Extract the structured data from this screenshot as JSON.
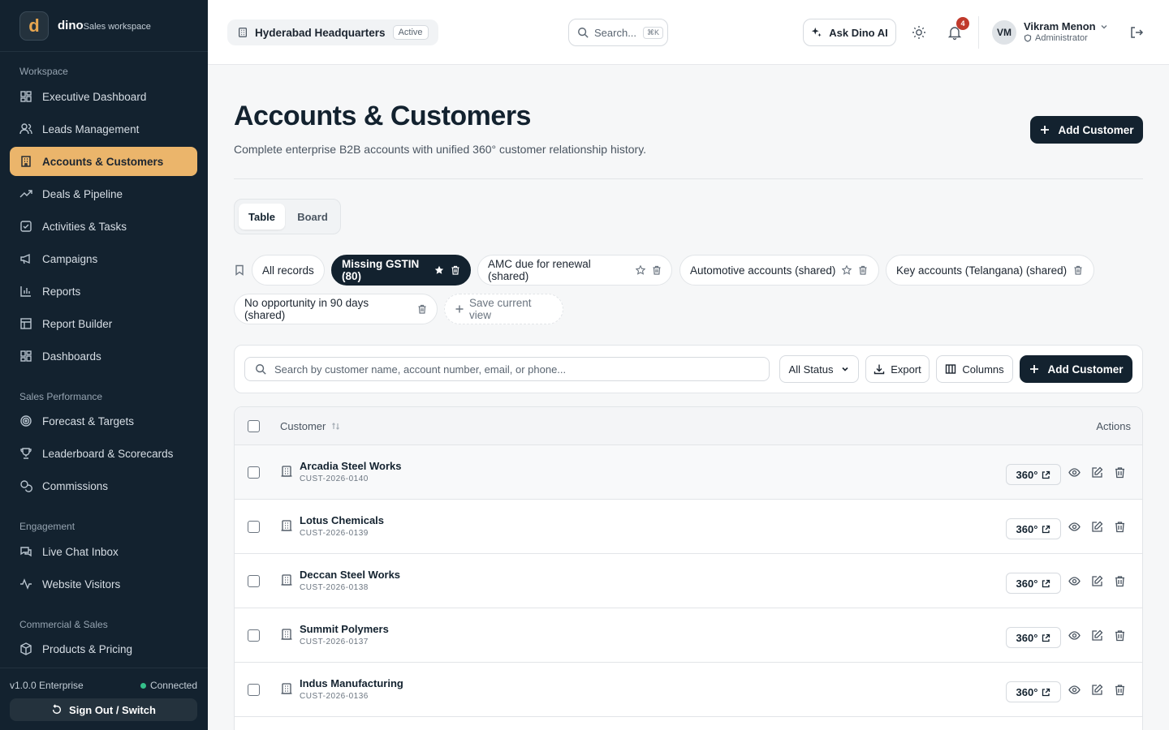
{
  "brand": {
    "logo_letter": "d",
    "name": "dino",
    "subtitle": "Sales workspace"
  },
  "sidebar": {
    "sections": [
      {
        "title": "Workspace"
      },
      {
        "title": "Sales Performance"
      },
      {
        "title": "Engagement"
      },
      {
        "title": "Commercial & Sales"
      }
    ],
    "items": [
      {
        "label": "Executive Dashboard",
        "icon": "dashboard-icon"
      },
      {
        "label": "Leads Management",
        "icon": "users-icon"
      },
      {
        "label": "Accounts & Customers",
        "icon": "building-icon",
        "active": true
      },
      {
        "label": "Deals & Pipeline",
        "icon": "trending-up-icon"
      },
      {
        "label": "Activities & Tasks",
        "icon": "checkbox-icon"
      },
      {
        "label": "Campaigns",
        "icon": "megaphone-icon"
      },
      {
        "label": "Reports",
        "icon": "bar-chart-icon"
      },
      {
        "label": "Report Builder",
        "icon": "layout-icon"
      },
      {
        "label": "Dashboards",
        "icon": "dashboard-icon"
      },
      {
        "label": "Forecast & Targets",
        "icon": "target-icon"
      },
      {
        "label": "Leaderboard & Scorecards",
        "icon": "trophy-icon"
      },
      {
        "label": "Commissions",
        "icon": "coins-icon"
      },
      {
        "label": "Live Chat Inbox",
        "icon": "chat-icon"
      },
      {
        "label": "Website Visitors",
        "icon": "activity-icon"
      },
      {
        "label": "Products & Pricing",
        "icon": "box-icon"
      }
    ],
    "version": "v1.0.0 Enterprise",
    "connection": "Connected",
    "sign_out_label": "Sign Out / Switch"
  },
  "topbar": {
    "location": "Hyderabad Headquarters",
    "location_status": "Active",
    "search_placeholder": "Search...",
    "search_shortcut": "⌘K",
    "ask_ai_label": "Ask Dino AI",
    "notification_count": "4",
    "user": {
      "initials": "VM",
      "name": "Vikram Menon",
      "role": "Administrator"
    }
  },
  "page": {
    "title": "Accounts & Customers",
    "subtitle": "Complete enterprise B2B accounts with unified 360° customer relationship history.",
    "add_customer_label": "Add Customer",
    "view_tabs": [
      "Table",
      "Board"
    ],
    "active_view": "Table",
    "saved_views": [
      {
        "label": "All records"
      },
      {
        "label": "Missing GSTIN (80)",
        "active": true
      },
      {
        "label": "AMC due for renewal (shared)"
      },
      {
        "label": "Automotive accounts (shared)"
      },
      {
        "label": "Key accounts (Telangana) (shared)"
      },
      {
        "label": "No opportunity in 90 days (shared)"
      }
    ],
    "save_view_label": "Save current view",
    "toolbar": {
      "search_placeholder": "Search by customer name, account number, email, or phone...",
      "status_filter": "All Status",
      "export_label": "Export",
      "columns_label": "Columns",
      "add_label": "Add Customer"
    },
    "table": {
      "headers": {
        "customer": "Customer",
        "actions": "Actions"
      },
      "view_360_label": "360°",
      "rows": [
        {
          "name": "Arcadia Steel Works",
          "id": "CUST-2026-0140"
        },
        {
          "name": "Lotus Chemicals",
          "id": "CUST-2026-0139"
        },
        {
          "name": "Deccan Steel Works",
          "id": "CUST-2026-0138"
        },
        {
          "name": "Summit Polymers",
          "id": "CUST-2026-0137"
        },
        {
          "name": "Indus Manufacturing",
          "id": "CUST-2026-0136"
        }
      ]
    }
  },
  "colors": {
    "sidebar_bg": "#13222f",
    "accent": "#ebb56b",
    "primary": "#13222f",
    "notification": "#c0392b",
    "connected": "#34c08a"
  }
}
